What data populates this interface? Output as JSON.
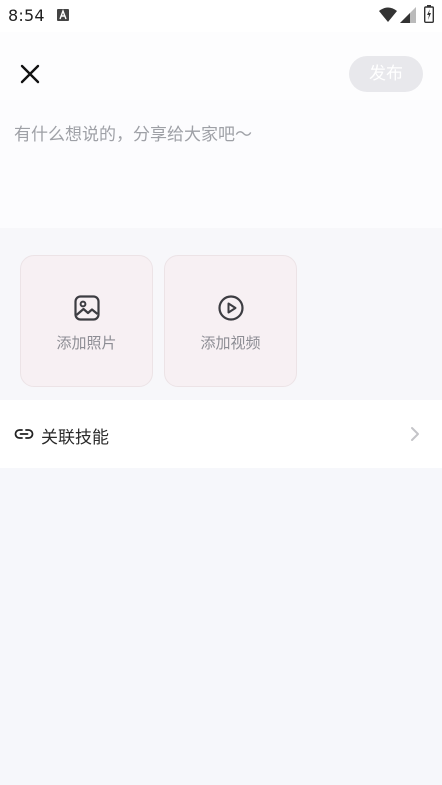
{
  "status_bar": {
    "time": "8:54"
  },
  "top_bar": {
    "publish_label": "发布"
  },
  "compose": {
    "placeholder": "有什么想说的，分享给大家吧～",
    "value": ""
  },
  "media": {
    "add_photo_label": "添加照片",
    "add_video_label": "添加视频"
  },
  "link_skill": {
    "label": "关联技能"
  },
  "icons": {
    "close": "close-icon",
    "photo": "image-icon",
    "video": "play-circle-icon",
    "link": "link-icon",
    "chevron": "chevron-right-icon"
  },
  "colors": {
    "background": "#f6f7fb",
    "publish_disabled_bg": "#e8e8ec",
    "tile_bg": "#f7f0f3",
    "placeholder_text": "#9ea0a6"
  }
}
